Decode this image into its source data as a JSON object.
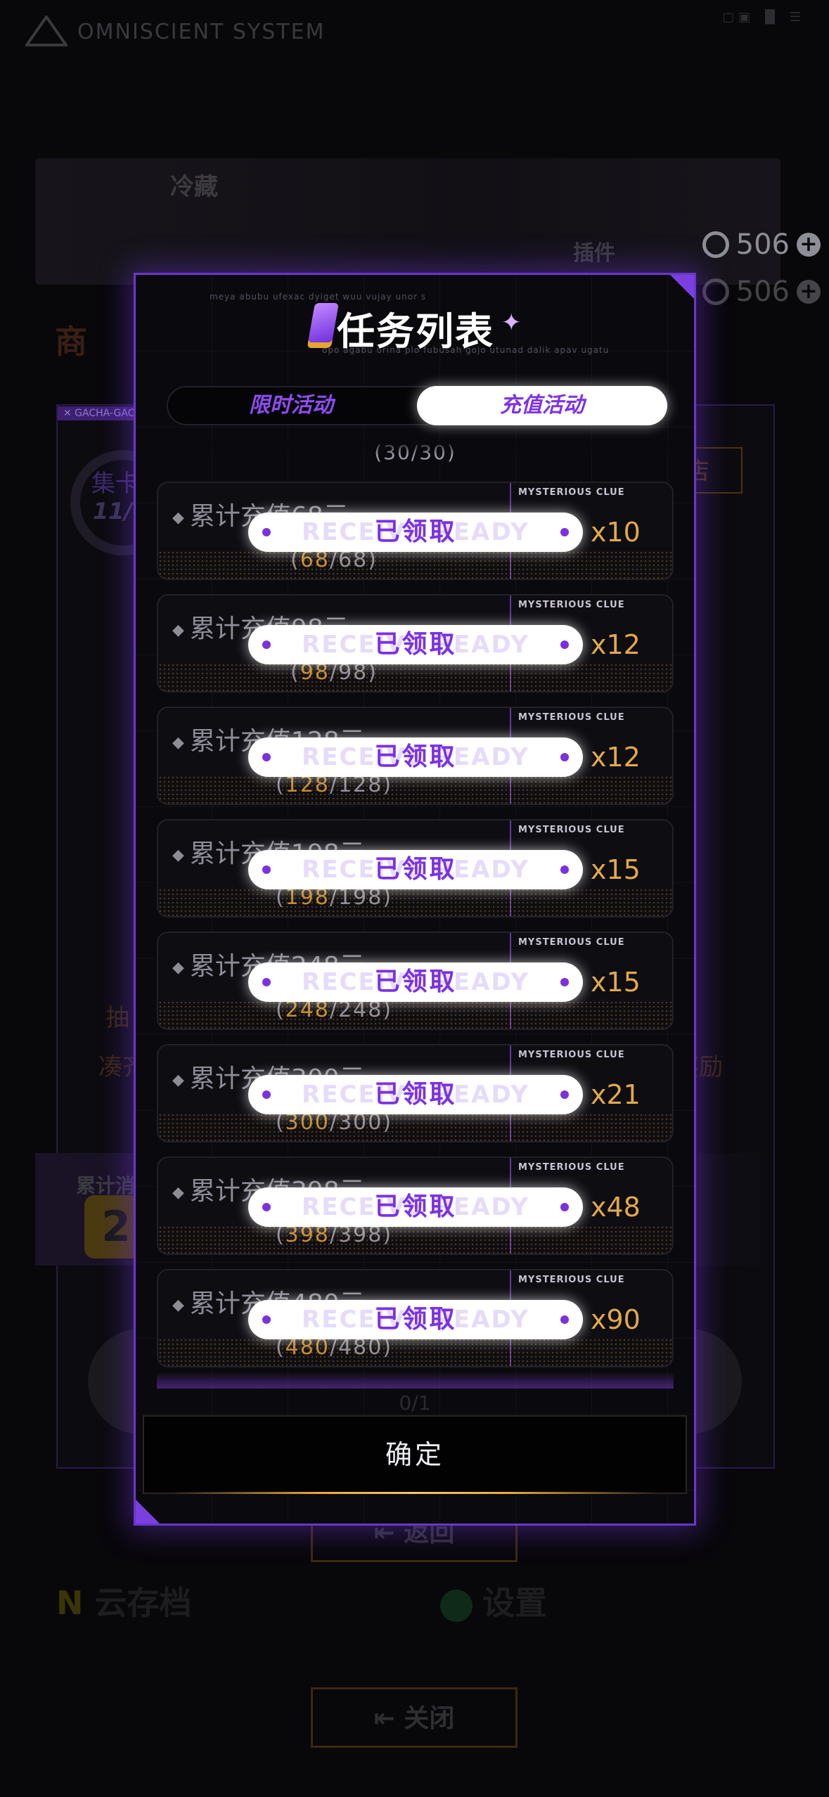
{
  "background": {
    "app_title": "OMNISCIENT SYSTEM",
    "banner_label": "冷藏",
    "plugin_label": "插件",
    "currency": [
      {
        "value": "506"
      },
      {
        "value": "506"
      }
    ],
    "shop_title": "商",
    "panel_tag": "✕ GACHA-GACH",
    "gacha_label": "集卡商",
    "gacha_count": "11/60",
    "shop_button": "卡商店",
    "line1": "抽",
    "line1_end": "励！",
    "line2": "凑齐",
    "line2_end": "奖励",
    "total_label": "累计消",
    "total_value": "2",
    "return_label": "返回",
    "close_label": "关闭",
    "cloud_save": "云存档",
    "settings": "设置"
  },
  "modal": {
    "title": "任务列表",
    "deco_top": "meya abubu ufexac dyiget wuu vujay unor s",
    "deco_bottom": "opo agabu orina plo fubusah gojo utunad dalik apav ugatu",
    "tabs": [
      {
        "label": "限时活动",
        "active": false
      },
      {
        "label": "充值活动",
        "active": true
      }
    ],
    "prev_count": "(30/30)",
    "tasks": [
      {
        "desc": "累计充值68元",
        "clue": "MYSTERIOUS CLUE",
        "mult": "x10",
        "button": "已领取",
        "ghost": "RECEIVE READY",
        "current": "68",
        "total": "/68"
      },
      {
        "desc": "累计充值98元",
        "clue": "MYSTERIOUS CLUE",
        "mult": "x12",
        "button": "已领取",
        "ghost": "RECEIVE READY",
        "current": "98",
        "total": "/98"
      },
      {
        "desc": "累计充值128元",
        "clue": "MYSTERIOUS CLUE",
        "mult": "x12",
        "button": "已领取",
        "ghost": "RECEIVE READY",
        "current": "128",
        "total": "/128"
      },
      {
        "desc": "累计充值198元",
        "clue": "MYSTERIOUS CLUE",
        "mult": "x15",
        "button": "已领取",
        "ghost": "RECEIVE READY",
        "current": "198",
        "total": "/198"
      },
      {
        "desc": "累计充值248元",
        "clue": "MYSTERIOUS CLUE",
        "mult": "x15",
        "button": "已领取",
        "ghost": "RECEIVE READY",
        "current": "248",
        "total": "/248"
      },
      {
        "desc": "累计充值300元",
        "clue": "MYSTERIOUS CLUE",
        "mult": "x21",
        "button": "已领取",
        "ghost": "RECEIVE READY",
        "current": "300",
        "total": "/300"
      },
      {
        "desc": "累计充值398元",
        "clue": "MYSTERIOUS CLUE",
        "mult": "x48",
        "button": "已领取",
        "ghost": "RECEIVE READY",
        "current": "398",
        "total": "/398"
      },
      {
        "desc": "累计充值480元",
        "clue": "MYSTERIOUS CLUE",
        "mult": "x90",
        "button": "已领取",
        "ghost": "RECEIVE READY",
        "current": "480",
        "total": "/480"
      }
    ],
    "below_count": "0/1",
    "confirm": "确定"
  }
}
